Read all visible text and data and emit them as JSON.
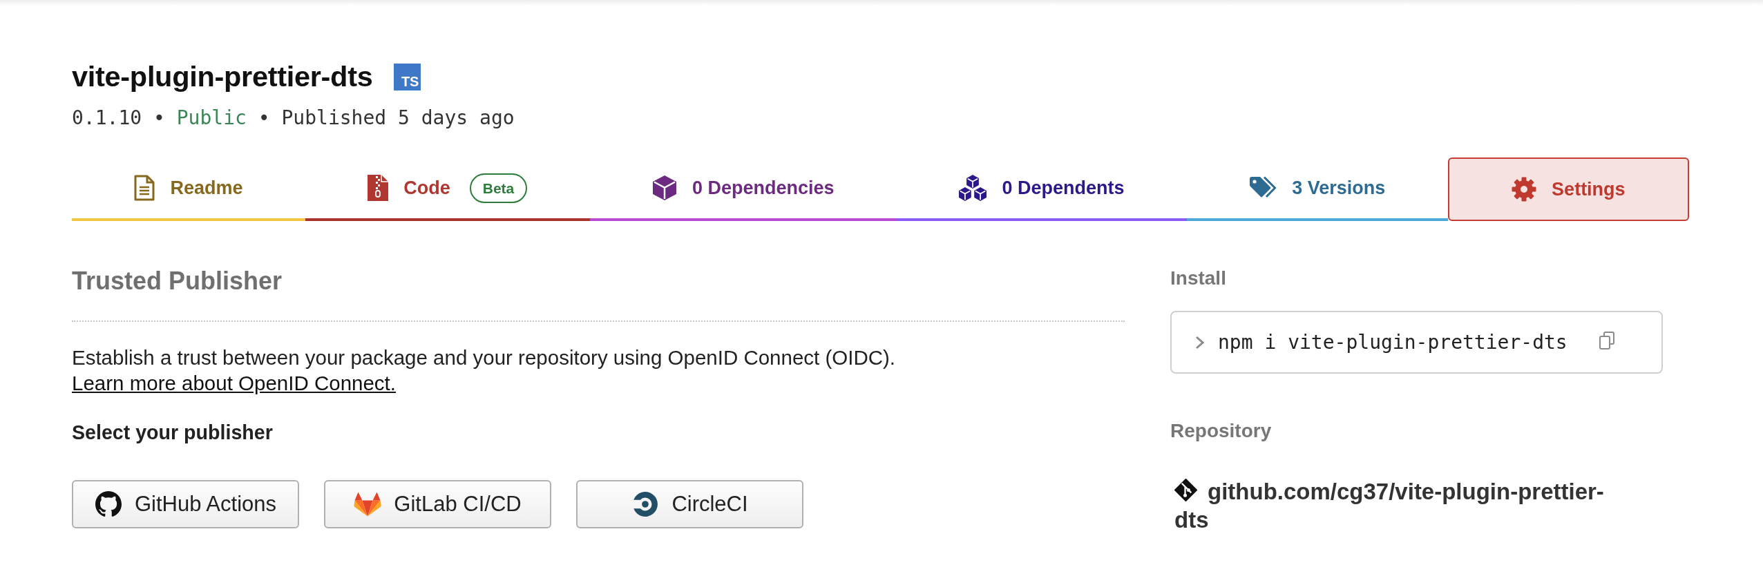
{
  "package": {
    "name": "vite-plugin-prettier-dts",
    "badge": "TS",
    "meta": [
      {
        "kind": "version",
        "text": "0.1.10"
      },
      {
        "kind": "separator",
        "text": "•"
      },
      {
        "kind": "visibility",
        "text": "Public"
      },
      {
        "kind": "separator",
        "text": "•"
      },
      {
        "kind": "date",
        "text": "Published 5 days ago"
      }
    ]
  },
  "tabs": [
    {
      "kind": "readme",
      "label": "Readme",
      "selected": false,
      "color": "#f4c542"
    },
    {
      "kind": "code",
      "label": "Code",
      "badge": "Beta",
      "selected": false,
      "color": "#a8342b"
    },
    {
      "kind": "dependencies",
      "label": "0 Dependencies",
      "selected": false,
      "color": "#b84ad4"
    },
    {
      "kind": "dependents",
      "label": "0 Dependents",
      "selected": false,
      "color": "#8a5cf5"
    },
    {
      "kind": "versions",
      "label": "3 Versions",
      "selected": false,
      "color": "#4ea8d8"
    },
    {
      "kind": "settings",
      "label": "Settings",
      "selected": true,
      "color": "#c53a31"
    }
  ],
  "trusted_publisher": {
    "title": "Trusted Publisher",
    "description": "Establish a trust between your package and your repository using OpenID Connect (OIDC).",
    "link": "Learn more about OpenID Connect.",
    "subheading": "Select your publisher",
    "publishers": [
      {
        "kind": "github",
        "label": "GitHub Actions"
      },
      {
        "kind": "gitlab",
        "label": "GitLab CI/CD"
      },
      {
        "kind": "circleci",
        "label": "CircleCI"
      }
    ]
  },
  "sidebar": {
    "install": {
      "title": "Install",
      "command": "npm i vite-plugin-prettier-dts"
    },
    "repository": {
      "title": "Repository",
      "link": "github.com/cg37/vite-plugin-prettier-dts"
    }
  }
}
